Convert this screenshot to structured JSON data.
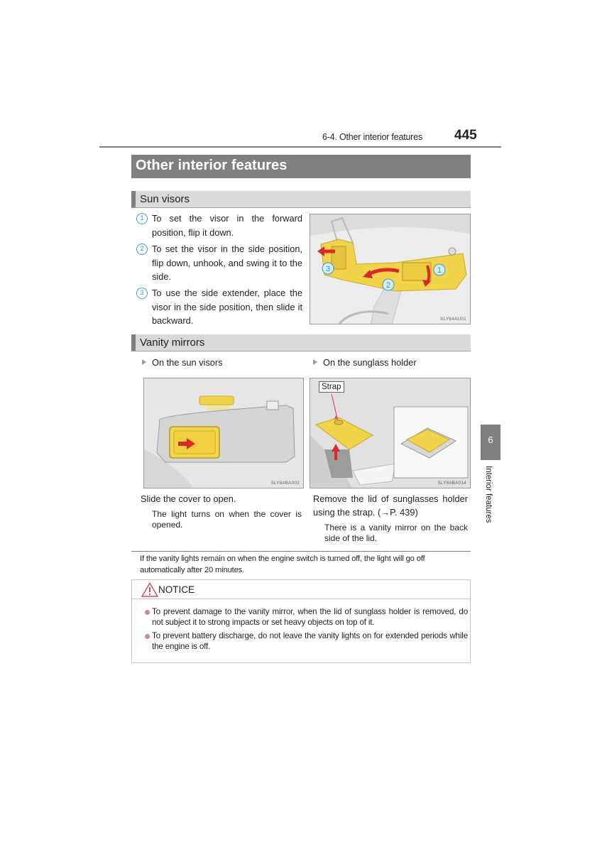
{
  "header": {
    "section": "6-4. Other interior features",
    "page_number": "445"
  },
  "title": "Other interior features",
  "sun_visors": {
    "heading": "Sun visors",
    "steps": [
      {
        "num": "1",
        "text": "To set the visor in the forward position, flip it down."
      },
      {
        "num": "2",
        "text": "To set the visor in the side position, flip down, unhook, and swing it to the side."
      },
      {
        "num": "3",
        "text": "To use the side extender, place the visor in the side position, then slide it backward."
      }
    ],
    "figure": {
      "code": "SLY64AU01",
      "callouts": [
        "1",
        "2",
        "3"
      ]
    }
  },
  "vanity_mirrors": {
    "heading": "Vanity mirrors",
    "left": {
      "label": "On the sun visors",
      "figure_code": "SLY64BA002",
      "instruction": "Slide the cover to open.",
      "note": "The light turns on when the cover is opened."
    },
    "right": {
      "label": "On the sunglass holder",
      "figure_code": "SLY64BA014",
      "figure_label": "Strap",
      "instruction": "Remove the lid of sunglasses holder using the strap. (→P. 439)",
      "note": "There is a vanity mirror on the back side of the lid."
    }
  },
  "info_note": "If the vanity lights remain on when the engine switch is turned off, the light will go off automatically after 20 minutes.",
  "notice": {
    "title": "NOTICE",
    "items": [
      "To prevent damage to the vanity mirror, when the lid of sunglass holder is removed, do not subject it to strong impacts or set heavy objects on top of it.",
      "To prevent battery discharge, do not leave the vanity lights on for extended periods while the engine is off."
    ]
  },
  "side_tab": {
    "chapter": "6",
    "label": "Interior features"
  },
  "colors": {
    "highlight_yellow": "#f2d44a",
    "arrow_red": "#d92a27",
    "callout_blue": "#3b9cc4",
    "notice_bullet": "#c98a95",
    "title_bar_gray": "#808080"
  }
}
